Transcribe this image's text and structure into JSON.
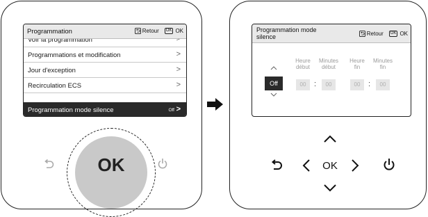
{
  "left_screen": {
    "header": {
      "title": "Programmation",
      "back_label": "Retour",
      "ok_badge": "OK",
      "ok_label": "OK"
    },
    "menu": [
      {
        "label": "Voir la programmation",
        "value": ""
      },
      {
        "label": "Programmations et modification",
        "value": ""
      },
      {
        "label": "Jour d'exception",
        "value": ""
      },
      {
        "label": "Recirculation ECS",
        "value": ""
      },
      {
        "label": "Programmation mode silence",
        "value": "Off",
        "selected": true
      }
    ]
  },
  "left_controls": {
    "ok_label": "OK"
  },
  "right_screen": {
    "header": {
      "title_line1": "Programmation mode",
      "title_line2": "silence",
      "back_label": "Retour",
      "ok_badge": "OK",
      "ok_label": "OK"
    },
    "toggle_value": "Off",
    "columns": {
      "start_hour_1": "Heure",
      "start_hour_2": "début",
      "start_min_1": "Minutes",
      "start_min_2": "début",
      "end_hour_1": "Heure",
      "end_hour_2": "fin",
      "end_min_1": "Minutes",
      "end_min_2": "fin"
    },
    "times": {
      "start_hour": "00",
      "start_min": "00",
      "end_hour": "00",
      "end_min": "00",
      "separator": ":"
    }
  },
  "right_controls": {
    "ok_label": "OK"
  },
  "icons": [
    "back-icon",
    "power-icon",
    "arrow-right-icon",
    "chevron-up-icon",
    "chevron-down-icon",
    "chevron-left-icon",
    "chevron-right-icon"
  ]
}
